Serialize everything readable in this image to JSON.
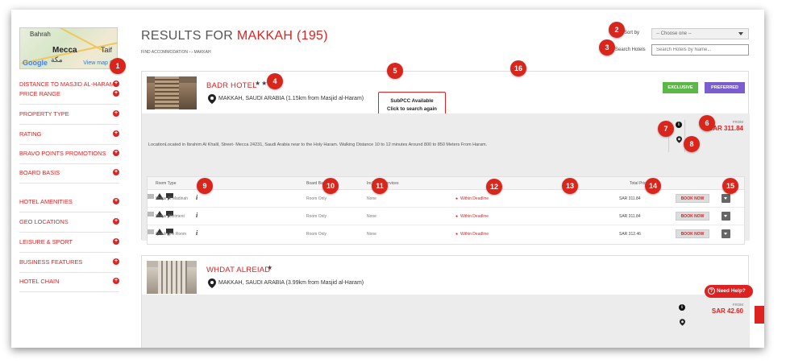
{
  "map": {
    "labels": [
      "Bahrah",
      "Mecca",
      "مكة",
      "Taif",
      "Google"
    ],
    "view_map": "View map"
  },
  "sidebar": {
    "filters": [
      {
        "label": "DISTANCE TO MASJID AL-HARAM"
      },
      {
        "label": "PRICE RANGE"
      },
      {
        "label": "PROPERTY TYPE"
      },
      {
        "label": "RATING"
      },
      {
        "label": "BRAVO POINTS PROMOTIONS"
      },
      {
        "label": "BOARD BASIS"
      },
      {
        "label": "HOTEL AMENITIES"
      },
      {
        "label": "GEO LOCATIONS"
      },
      {
        "label": "LEISURE & SPORT"
      },
      {
        "label": "BUSINESS FEATURES"
      },
      {
        "label": "HOTEL CHAIN"
      }
    ]
  },
  "header": {
    "title_prefix": "RESULTS FOR",
    "title_city": "MAKKAH (195)",
    "breadcrumb": "FIND ACCOMMODATION › › MAKKAH",
    "sort_label": "Sort by",
    "sort_value": "-- Choose one --",
    "search_label": "Search Hotels",
    "search_placeholder": "Search Hotels by Name..."
  },
  "hotels": [
    {
      "name": "BADR HOTEL",
      "stars": "★★★",
      "address": "MAKKAH, SAUDI ARABIA (1.15km from Masjid al-Haram)",
      "subpcc_line1": "SubPCC Available",
      "subpcc_line2": "Click to search again",
      "tag_exclusive": "EXCLUSIVE",
      "tag_preferred": "PREFERRED",
      "location": "LocationLocated in Ibrahim Al Khalil, Street- Mecca 24231, Saudi Arabia near to the Holy Haram. Walking Distance 10 to 12 minutes Around 800 to 850 Meters From Haram.",
      "from_label": "FROM",
      "price": "SAR 311.84",
      "room_headers": {
        "room_type": "Room Type",
        "board_basis": "Board Basis",
        "included_services": "Included Services",
        "total_price": "Total Price"
      },
      "rooms": [
        {
          "type": "Matjar Al Madinah",
          "basis": "Room Only",
          "services": "None",
          "deadline": "Within Deadline",
          "price": "SAR 311.84",
          "action": "BOOK NOW"
        },
        {
          "type": "Matjar Allotment",
          "basis": "Room Only",
          "services": "None",
          "deadline": "Within Deadline",
          "price": "SAR 311.84",
          "action": "BOOK NOW"
        },
        {
          "type": "Quadruple Room",
          "basis": "Room Only",
          "services": "None",
          "deadline": "Within Deadline",
          "price": "SAR 312.46",
          "action": "BOOK NOW"
        }
      ]
    },
    {
      "name": "WHDAT ALREIAD",
      "stars": "★",
      "address": "MAKKAH, SAUDI ARABIA (3.99km from Masjid al-Haram)",
      "from_label": "FROM",
      "price": "SAR 42.60"
    }
  ],
  "help": {
    "label": "Need Help?",
    "q": "?"
  },
  "callouts": [
    "1",
    "2",
    "3",
    "4",
    "5",
    "6",
    "7",
    "8",
    "9",
    "10",
    "11",
    "12",
    "13",
    "14",
    "15",
    "16"
  ],
  "colors": {
    "accent": "#d22222",
    "exclusive": "#5bb846",
    "preferred": "#7a5ed0",
    "callout": "#d9261c"
  }
}
